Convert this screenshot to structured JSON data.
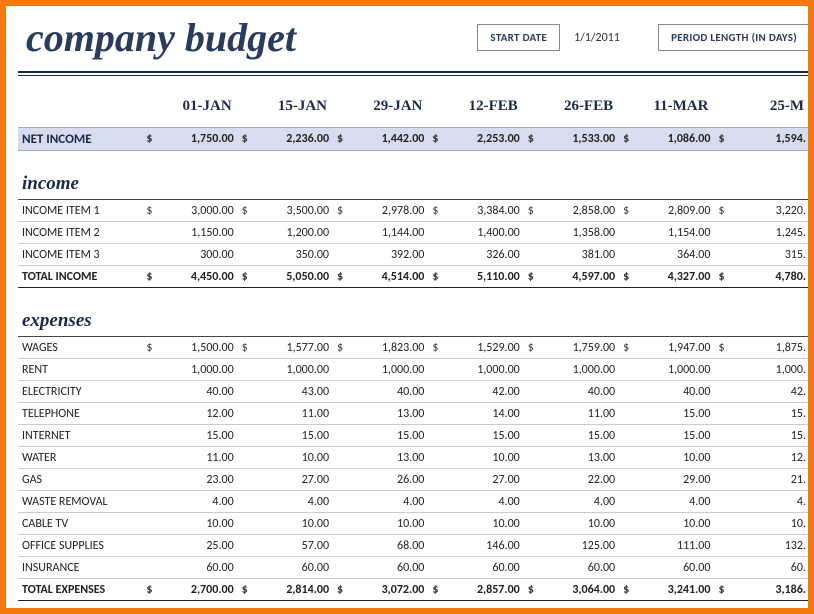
{
  "header": {
    "title": "company budget",
    "start_date_label": "START DATE",
    "start_date_value": "1/1/2011",
    "period_label": "PERIOD LENGTH (IN DAYS)"
  },
  "columns": [
    "01-JAN",
    "15-JAN",
    "29-JAN",
    "12-FEB",
    "26-FEB",
    "11-MAR",
    "25-M"
  ],
  "net_income": {
    "label": "NET INCOME",
    "values": [
      "1,750.00",
      "2,236.00",
      "1,442.00",
      "2,253.00",
      "1,533.00",
      "1,086.00",
      "1,594."
    ]
  },
  "income": {
    "heading": "income",
    "rows": [
      {
        "label": "INCOME ITEM 1",
        "show_dollar": true,
        "values": [
          "3,000.00",
          "3,500.00",
          "2,978.00",
          "3,384.00",
          "2,858.00",
          "2,809.00",
          "3,220."
        ]
      },
      {
        "label": "INCOME ITEM 2",
        "show_dollar": false,
        "values": [
          "1,150.00",
          "1,200.00",
          "1,144.00",
          "1,400.00",
          "1,358.00",
          "1,154.00",
          "1,245."
        ]
      },
      {
        "label": "INCOME ITEM 3",
        "show_dollar": false,
        "values": [
          "300.00",
          "350.00",
          "392.00",
          "326.00",
          "381.00",
          "364.00",
          "315."
        ]
      }
    ],
    "total": {
      "label": "TOTAL INCOME",
      "values": [
        "4,450.00",
        "5,050.00",
        "4,514.00",
        "5,110.00",
        "4,597.00",
        "4,327.00",
        "4,780."
      ]
    }
  },
  "expenses": {
    "heading": "expenses",
    "rows": [
      {
        "label": "WAGES",
        "show_dollar": true,
        "values": [
          "1,500.00",
          "1,577.00",
          "1,823.00",
          "1,529.00",
          "1,759.00",
          "1,947.00",
          "1,875."
        ]
      },
      {
        "label": "RENT",
        "show_dollar": false,
        "values": [
          "1,000.00",
          "1,000.00",
          "1,000.00",
          "1,000.00",
          "1,000.00",
          "1,000.00",
          "1,000."
        ]
      },
      {
        "label": "ELECTRICITY",
        "show_dollar": false,
        "values": [
          "40.00",
          "43.00",
          "40.00",
          "42.00",
          "40.00",
          "40.00",
          "42."
        ]
      },
      {
        "label": "TELEPHONE",
        "show_dollar": false,
        "values": [
          "12.00",
          "11.00",
          "13.00",
          "14.00",
          "11.00",
          "15.00",
          "15."
        ]
      },
      {
        "label": "INTERNET",
        "show_dollar": false,
        "values": [
          "15.00",
          "15.00",
          "15.00",
          "15.00",
          "15.00",
          "15.00",
          "15."
        ]
      },
      {
        "label": "WATER",
        "show_dollar": false,
        "values": [
          "11.00",
          "10.00",
          "13.00",
          "10.00",
          "13.00",
          "10.00",
          "12."
        ]
      },
      {
        "label": "GAS",
        "show_dollar": false,
        "values": [
          "23.00",
          "27.00",
          "26.00",
          "27.00",
          "22.00",
          "29.00",
          "21."
        ]
      },
      {
        "label": "WASTE REMOVAL",
        "show_dollar": false,
        "values": [
          "4.00",
          "4.00",
          "4.00",
          "4.00",
          "4.00",
          "4.00",
          "4."
        ]
      },
      {
        "label": "CABLE TV",
        "show_dollar": false,
        "values": [
          "10.00",
          "10.00",
          "10.00",
          "10.00",
          "10.00",
          "10.00",
          "10."
        ]
      },
      {
        "label": "OFFICE SUPPLIES",
        "show_dollar": false,
        "values": [
          "25.00",
          "57.00",
          "68.00",
          "146.00",
          "125.00",
          "111.00",
          "132."
        ]
      },
      {
        "label": "INSURANCE",
        "show_dollar": false,
        "values": [
          "60.00",
          "60.00",
          "60.00",
          "60.00",
          "60.00",
          "60.00",
          "60."
        ]
      }
    ],
    "total": {
      "label": "TOTAL EXPENSES",
      "values": [
        "2,700.00",
        "2,814.00",
        "3,072.00",
        "2,857.00",
        "3,064.00",
        "3,241.00",
        "3,186."
      ]
    }
  }
}
